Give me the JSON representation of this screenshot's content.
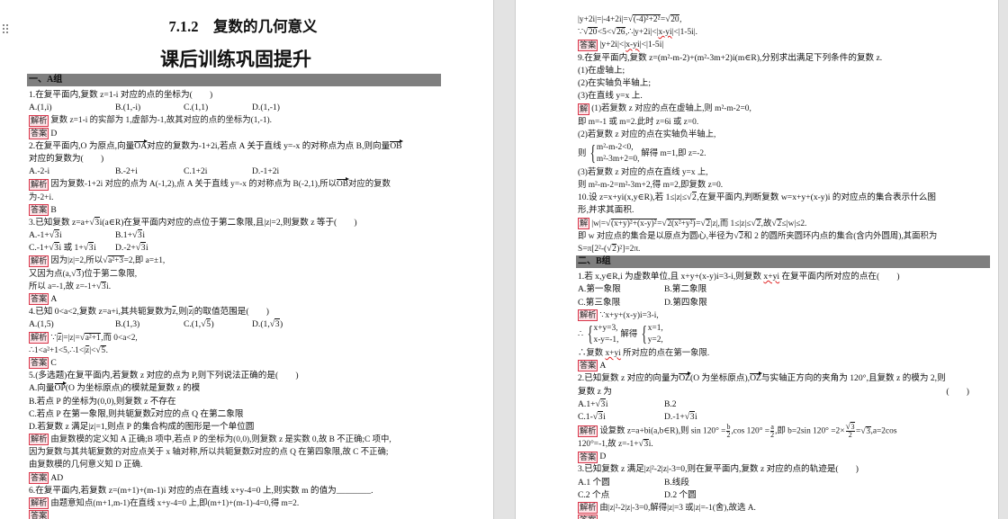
{
  "document": {
    "title": "7.1.2　复数的几何意义",
    "subtitle": "课后训练巩固提升"
  },
  "symbols": {
    "sqrt": "√",
    "brace": "{"
  },
  "colors": {
    "section_bar": "#7f7f7f",
    "label_border": "#d8364a",
    "label_fill": "#fde3e7",
    "spellcheck": "#e02020"
  },
  "pages": [
    {
      "blocks": [
        {
          "k": "bar",
          "t": "一、A组"
        },
        {
          "k": "q",
          "s": [
            "1.在复平面内,复数 z=1-i 对应的点的坐标为(　　)"
          ]
        },
        {
          "k": "o",
          "opts": [
            [
              "A.(1,i)"
            ],
            [
              "B.(1,-i)"
            ],
            [
              "C.(1,1)"
            ],
            [
              "D.(1,-1)"
            ]
          ]
        },
        {
          "k": "s",
          "s": [
            {
              "b": "解析"
            },
            "复数 z=1-i 的实部为 1,虚部为-1,故其对应的点的坐标为(1,-1)."
          ]
        },
        {
          "k": "a",
          "s": [
            {
              "b": "答案"
            },
            "D"
          ]
        },
        {
          "k": "q",
          "s": [
            "2.在复平面内,O 为原点,向量",
            {
              "v": "OA"
            },
            "对应的复数为-1+2i,若点 A 关于直线 y=-x 的对称点为点 B,则向量",
            {
              "v": "OB"
            }
          ]
        },
        {
          "k": "q",
          "s": [
            "对应的复数为(　　)"
          ]
        },
        {
          "k": "o",
          "opts": [
            [
              "A.-2-i"
            ],
            [
              "B.-2+i"
            ],
            [
              "C.1+2i"
            ],
            [
              "D.-1+2i"
            ]
          ]
        },
        {
          "k": "s",
          "s": [
            {
              "b": "解析"
            },
            "因为复数-1+2i 对应的点为 A(-1,2),点 A 关于直线 y=-x 的对称点为 B(-2,1),所以",
            {
              "v": "OB"
            },
            "对应的复数"
          ]
        },
        {
          "k": "s",
          "s": [
            "为-2+i."
          ]
        },
        {
          "k": "a",
          "s": [
            {
              "b": "答案"
            },
            "B"
          ]
        },
        {
          "k": "q",
          "s": [
            "3.已知复数 z=a+",
            {
              "r": "3"
            },
            "i(a∈R)在复平面内对应的点位于第二象限,且|z|=2,则复数 z 等于(　　)"
          ]
        },
        {
          "k": "o",
          "opts": [
            [
              "A.-1+",
              {
                "r": "3"
              },
              "i"
            ],
            [
              "B.1+",
              {
                "r": "3"
              },
              "i"
            ]
          ]
        },
        {
          "k": "o",
          "opts": [
            [
              "C.-1+",
              {
                "r": "3"
              },
              "i 或 1+",
              {
                "r": "3"
              },
              "i"
            ],
            [
              "D.-2+",
              {
                "r": "3"
              },
              "i"
            ]
          ]
        },
        {
          "k": "s",
          "s": [
            {
              "b": "解析"
            },
            "因为|z|=2,所以",
            {
              "r": "a²+3"
            },
            "=2,即 a=±1,"
          ]
        },
        {
          "k": "s",
          "s": [
            "又因为点(a,",
            {
              "r": "3"
            },
            ")位于第二象限,"
          ]
        },
        {
          "k": "s",
          "s": [
            "所以 a=-1,故 z=-1+",
            {
              "r": "3"
            },
            "i."
          ]
        },
        {
          "k": "a",
          "s": [
            {
              "b": "答案"
            },
            "A"
          ]
        },
        {
          "k": "q",
          "s": [
            "4.已知 0<a<2,复数 z=a+i,其共轭复数为",
            {
              "o": "z"
            },
            ",则|",
            {
              "o": "z"
            },
            "|的取值范围是(　　)"
          ]
        },
        {
          "k": "o",
          "opts": [
            [
              "A.(1,5)"
            ],
            [
              "B.(1,3)"
            ],
            [
              "C.(1,",
              {
                "r": "5"
              },
              ")"
            ],
            [
              "D.(1,",
              {
                "r": "3"
              },
              ")"
            ]
          ]
        },
        {
          "k": "s",
          "s": [
            {
              "b": "解析"
            },
            "∵|",
            {
              "o": "z"
            },
            "|=|z|=",
            {
              "r": "a²+1"
            },
            ",而 0<a<2,"
          ]
        },
        {
          "k": "s",
          "s": [
            "∴1<a²+1<5,∴1<|",
            {
              "o": "z"
            },
            "|<",
            {
              "r": "5"
            },
            "."
          ]
        },
        {
          "k": "a",
          "s": [
            {
              "b": "答案"
            },
            "C"
          ]
        },
        {
          "k": "q",
          "s": [
            "5.(多选题)在复平面内,若复数 z 对应的点为 P,则下列说法正确的是(　　)"
          ]
        },
        {
          "k": "q",
          "s": [
            "A.向量",
            {
              "v": "OP"
            },
            "(O 为坐标原点)的模就是复数 z 的模"
          ]
        },
        {
          "k": "q",
          "s": [
            "B.若点 P 的坐标为(0,0),则复数 z 不存在"
          ]
        },
        {
          "k": "q",
          "s": [
            "C.若点 P 在第一象限,则共轭复数",
            {
              "o": "z"
            },
            "对应的点 Q 在第二象限"
          ]
        },
        {
          "k": "q",
          "s": [
            "D.若复数 z 满足|z|=1,则点 P 的集合构成的图形是一个单位圆"
          ]
        },
        {
          "k": "s",
          "s": [
            {
              "b": "解析"
            },
            "由复数模的定义知 A 正确;B 项中,若点 P 的坐标为(0,0),则复数 z 是实数 0,故 B 不正确;C 项中,"
          ]
        },
        {
          "k": "s",
          "s": [
            "因为复数与其共轭复数的对应点关于 x 轴对称,所以共轭复数",
            {
              "o": "z"
            },
            "对应的点 Q 在第四象限,故 C 不正确;"
          ]
        },
        {
          "k": "s",
          "s": [
            "由复数模的几何意义知 D 正确."
          ]
        },
        {
          "k": "a",
          "s": [
            {
              "b": "答案"
            },
            "AD"
          ]
        },
        {
          "k": "q",
          "s": [
            "6.在复平面内,若复数 z=(m+1)+(m-1)i 对应的点在直线 x+y-4=0 上,则实数 m 的值为________."
          ]
        },
        {
          "k": "s",
          "s": [
            {
              "b": "解析"
            },
            "由题意知点(m+1,m-1)在直线 x+y-4=0 上,即(m+1)+(m-1)-4=0,得 m=2."
          ]
        },
        {
          "k": "a",
          "s": [
            {
              "b": "答案"
            }
          ]
        }
      ]
    },
    {
      "blocks": [
        {
          "k": "s",
          "s": [
            "|y+2i|=|-4+2i|=",
            {
              "r": "(-4)²+2²"
            },
            "=",
            {
              "r": "20"
            },
            ","
          ]
        },
        {
          "k": "s",
          "s": [
            "∵",
            {
              "r": "20"
            },
            "<5<",
            {
              "r": "26"
            },
            ",∴|y+2i|<|",
            {
              "u": "x-yi"
            },
            "|<|1-5i|."
          ]
        },
        {
          "k": "a",
          "s": [
            {
              "b": "答案"
            },
            "|y+2i|<|",
            {
              "u": "x-yi"
            },
            "|<|1-5i|"
          ]
        },
        {
          "k": "q",
          "s": [
            "9.在复平面内,复数 z=(m²-m-2)+(m²-3m+2)i(m∈R),分别求出满足下列条件的复数 z."
          ]
        },
        {
          "k": "q",
          "s": [
            "(1)在虚轴上;"
          ]
        },
        {
          "k": "q",
          "s": [
            "(2)在实轴负半轴上;"
          ]
        },
        {
          "k": "q",
          "s": [
            "(3)在直线 y=x 上."
          ]
        },
        {
          "k": "s",
          "s": [
            {
              "b": "解"
            },
            "(1)若复数 z 对应的点在虚轴上,则 m²-m-2=0,"
          ]
        },
        {
          "k": "s",
          "s": [
            "即 m=-1 或 m=2.此时 z=6i 或 z=0."
          ]
        },
        {
          "k": "s",
          "s": [
            "(2)若复数 z 对应的点在实轴负半轴上,"
          ]
        },
        {
          "k": "s",
          "s": [
            "则",
            {
              "sys": [
                [
                  "m²-m-2<0,"
                ],
                [
                  "m²-3m+2=0,"
                ]
              ]
            },
            "解得 m=1,即 z=-2."
          ]
        },
        {
          "k": "s",
          "s": [
            "(3)若复数 z 对应的点在直线 y=x 上,"
          ]
        },
        {
          "k": "s",
          "s": [
            "则 m²-m-2=m²-3m+2,得 m=2,即复数 z=0."
          ]
        },
        {
          "k": "q",
          "s": [
            "10.设 z=x+yi(x,y∈R),若 1≤|z|≤",
            {
              "r": "2"
            },
            ",在复平面内,判断复数 w=x+y+(x-y)i 的对应点的集合表示什么图"
          ]
        },
        {
          "k": "q",
          "s": [
            "形,并求其面积."
          ]
        },
        {
          "k": "s",
          "s": [
            {
              "b": "解"
            },
            "|w|=",
            {
              "r": "(x+y)²+(x-y)²"
            },
            "=",
            {
              "r": "2(x²+y²)"
            },
            "=",
            {
              "r": "2"
            },
            "|z|,而 1≤|z|≤",
            {
              "r": "2"
            },
            ",故",
            {
              "r": "2"
            },
            "≤|w|≤2."
          ]
        },
        {
          "k": "s",
          "s": [
            "即 w 对应点的集合是以原点为圆心,半径为",
            {
              "r": "2"
            },
            "和 2 的圆所夹圆环内点的集合(含内外圆周),其面积为"
          ]
        },
        {
          "k": "s",
          "s": [
            "S=π[2²-(",
            {
              "r": "2"
            },
            ")²]=2π."
          ]
        },
        {
          "k": "bar",
          "t": "二、B组"
        },
        {
          "k": "q",
          "s": [
            "1.若 x,y∈R,i 为虚数单位,且 x+y+(x-y)i=3-i,则复数 ",
            {
              "u": "x+yi"
            },
            " 在复平面内所对应的点在(　　)"
          ]
        },
        {
          "k": "o",
          "opts": [
            [
              "A.第一象限"
            ],
            [
              "B.第二象限"
            ]
          ]
        },
        {
          "k": "o",
          "opts": [
            [
              "C.第三象限"
            ],
            [
              "D.第四象限"
            ]
          ]
        },
        {
          "k": "s",
          "s": [
            {
              "b": "解析"
            },
            "∵x+y+(x-y)i=3-i,"
          ]
        },
        {
          "k": "s",
          "s": [
            "∴",
            {
              "sys": [
                [
                  "x+y=3,"
                ],
                [
                  "x-y=-1,"
                ]
              ]
            },
            "解得",
            {
              "sys": [
                [
                  "x=1,"
                ],
                [
                  "y=2,"
                ]
              ]
            }
          ]
        },
        {
          "k": "s",
          "s": [
            "∴复数 ",
            {
              "u": "x+yi"
            },
            " 所对应的点在第一象限."
          ]
        },
        {
          "k": "a",
          "s": [
            {
              "b": "答案"
            },
            "A"
          ]
        },
        {
          "k": "q",
          "s": [
            "2.已知复数 z 对应的向量为",
            {
              "v": "OZ"
            },
            "(O 为坐标原点),",
            {
              "v": "OZ"
            },
            "与实轴正方向的夹角为 120°,且复数 z 的模为 2,则"
          ]
        },
        {
          "k": "q",
          "s": [
            "复数 z 为",
            {
              "rt": "(　　)"
            }
          ]
        },
        {
          "k": "o",
          "opts": [
            [
              "A.1+",
              {
                "r": "3"
              },
              "i"
            ],
            [
              "B.2"
            ]
          ]
        },
        {
          "k": "o",
          "opts": [
            [
              "C.1-",
              {
                "r": "3"
              },
              "i"
            ],
            [
              "D.-1+",
              {
                "r": "3"
              },
              "i"
            ]
          ]
        },
        {
          "k": "s",
          "s": [
            {
              "b": "解析"
            },
            "设复数 z=a+bi(a,b∈R),则 sin 120° =",
            {
              "f": [
                [
                  "b"
                ],
                [
                  "2"
                ]
              ]
            },
            ",cos 120° =",
            {
              "f": [
                [
                  "a"
                ],
                [
                  "2"
                ]
              ]
            },
            ",即 b=2sin 120° =2×",
            {
              "f": [
                [
                  {
                    "r": "3"
                  }
                ],
                [
                  "2"
                ]
              ]
            },
            "=",
            {
              "r": "3"
            },
            ",a=2cos"
          ]
        },
        {
          "k": "s",
          "s": [
            "120°=-1,故 z=-1+",
            {
              "r": "3"
            },
            "i."
          ]
        },
        {
          "k": "a",
          "s": [
            {
              "b": "答案"
            },
            "D"
          ]
        },
        {
          "k": "q",
          "s": [
            "3.已知复数 z 满足|z|²-2|z|-3=0,则在复平面内,复数 z 对应的点的轨迹是(　　)"
          ]
        },
        {
          "k": "o",
          "opts": [
            [
              "A.1 个圆"
            ],
            [
              "B.线段"
            ]
          ]
        },
        {
          "k": "o",
          "opts": [
            [
              "C.2 个点"
            ],
            [
              "D.2 个圆"
            ]
          ]
        },
        {
          "k": "s",
          "s": [
            {
              "b": "解析"
            },
            "由|z|²-2|z|-3=0,解得|z|=3 或|z|=-1(舍),故选 A."
          ]
        },
        {
          "k": "a",
          "s": [
            {
              "b": "答案"
            }
          ]
        }
      ]
    }
  ]
}
